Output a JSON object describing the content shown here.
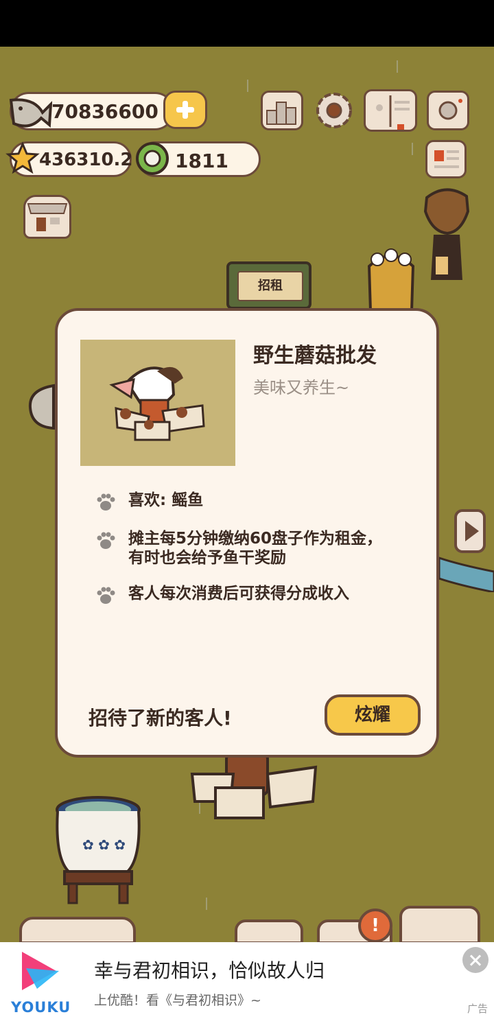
{
  "hud": {
    "fish_count": "70836600",
    "star_count": "436310.2",
    "coin_count": "1811",
    "icons": [
      "fish-icon",
      "plus-icon",
      "star-icon",
      "coin-icon",
      "ranking-icon",
      "settings-gear-icon",
      "book-icon",
      "camera-icon",
      "id-card-icon",
      "shop-icon"
    ]
  },
  "world": {
    "sign_label": "招租"
  },
  "modal": {
    "title": "野生蘑菇批发",
    "subtitle": "美味又养生~",
    "features": [
      "喜欢: 鳐鱼",
      "摊主每5分钟缴纳60盘子作为租金，",
      "有时也会给予鱼干奖励",
      "客人每次消费后可获得分成收入"
    ],
    "footer_text": "招待了新的客人!",
    "share_button": "炫耀"
  },
  "ad": {
    "brand": "YOUKU",
    "title": "幸与君初相识，恰似故人归",
    "subtitle": "上优酷！看《与君初相识》~",
    "tag": "广告"
  },
  "colors": {
    "background": "#8d8237",
    "panel": "#fdf5ec",
    "border": "#6b4a3a",
    "button": "#f7c84a",
    "youku_blue": "#2a7fd8",
    "youku_pink": "#f23f7a"
  }
}
